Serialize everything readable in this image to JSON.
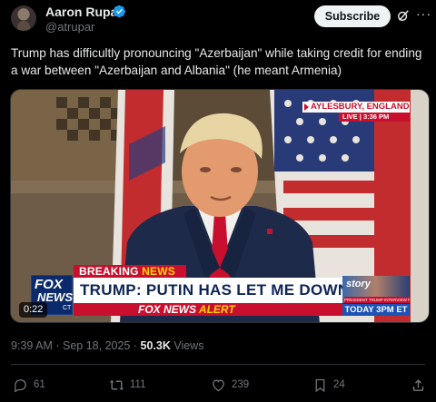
{
  "author": {
    "name": "Aaron Rupar",
    "handle": "@atrupar",
    "verified": true
  },
  "header": {
    "subscribe_label": "Subscribe",
    "grok_icon": "grok-slash-icon",
    "more_icon": "more-dots-icon"
  },
  "tweet": {
    "text": "Trump has difficultly pronouncing \"Azerbaijan\" while taking credit for ending a war between \"Azerbaijan and Albania\" (he meant Armenia)"
  },
  "video": {
    "duration": "0:22",
    "location": "AYLESBURY, ENGLAND",
    "live_label": "LIVE",
    "live_time": "3:36 PM",
    "breaking_prefix": "BREAKING",
    "breaking_suffix": "NEWS",
    "headline": "TRUMP: PUTIN HAS LET ME DOWN",
    "alert_brand": "FOX NEWS",
    "alert_word": "ALERT",
    "logo_line1": "FOX",
    "logo_line2": "NEWS",
    "logo_ct": "CT",
    "promo_title": "story",
    "promo_sub": "PRESIDENT TRUMP INTERVIEW FROM THE U.K.",
    "promo_time": "TODAY 3PM ET"
  },
  "meta": {
    "time": "9:39 AM",
    "date": "Sep 18, 2025",
    "views_count": "50.3K",
    "views_label": "Views"
  },
  "actions": {
    "replies": "61",
    "reposts": "111",
    "likes": "239",
    "bookmarks": "24"
  },
  "colors": {
    "background": "#000000",
    "text": "#e7e9ea",
    "secondary": "#71767b",
    "verified": "#1d9bf0",
    "fox_red": "#c8102e",
    "fox_blue": "#0b2a6b"
  }
}
